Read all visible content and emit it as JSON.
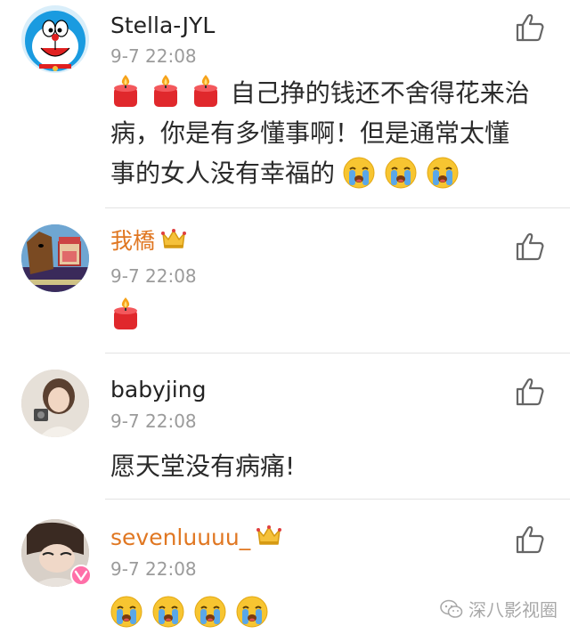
{
  "comments": [
    {
      "username": "Stella-JYL",
      "time": "9-7 22:08",
      "text_line1": "自己挣的钱还不舍得花来治",
      "text_line2": "病，你是有多懂事啊！但是通常太懂",
      "text_line3": "事的女人没有幸福的",
      "name_color": "#222222",
      "avatar_icon": "doraemon-avatar",
      "emojis_before": [
        "candle-icon",
        "candle-icon",
        "candle-icon"
      ],
      "emojis_after": [
        "crying-face-icon",
        "crying-face-icon",
        "crying-face-icon"
      ]
    },
    {
      "username": "我橋",
      "time": "9-7 22:08",
      "name_color": "#e07722",
      "avatar_icon": "cartoon-horse-avatar",
      "vip_icon": "vip-crown-icon",
      "emojis": [
        "candle-icon"
      ]
    },
    {
      "username": "babyjing",
      "time": "9-7 22:08",
      "text": "愿天堂没有病痛!",
      "name_color": "#222222",
      "avatar_icon": "girl-photo-avatar"
    },
    {
      "username": "sevenluuuu_",
      "time": "9-7 22:08",
      "name_color": "#e07722",
      "avatar_icon": "girl-photo-avatar",
      "vip_icon": "vip-crown-icon",
      "badge_icon": "verified-v-badge-icon",
      "emojis": [
        "crying-face-icon",
        "crying-face-icon",
        "crying-face-icon",
        "crying-face-icon"
      ]
    }
  ],
  "watermark": {
    "text": "深八影视圈",
    "icon": "wechat-icon"
  },
  "colors": {
    "orange_name": "#e07722",
    "time_gray": "#9b9b9b",
    "divider": "#e3e3e3",
    "candle_red": "#e0282c",
    "flame_orange": "#f6a21a",
    "emoji_yellow": "#f7c531",
    "tear_blue": "#5aa7e8"
  }
}
